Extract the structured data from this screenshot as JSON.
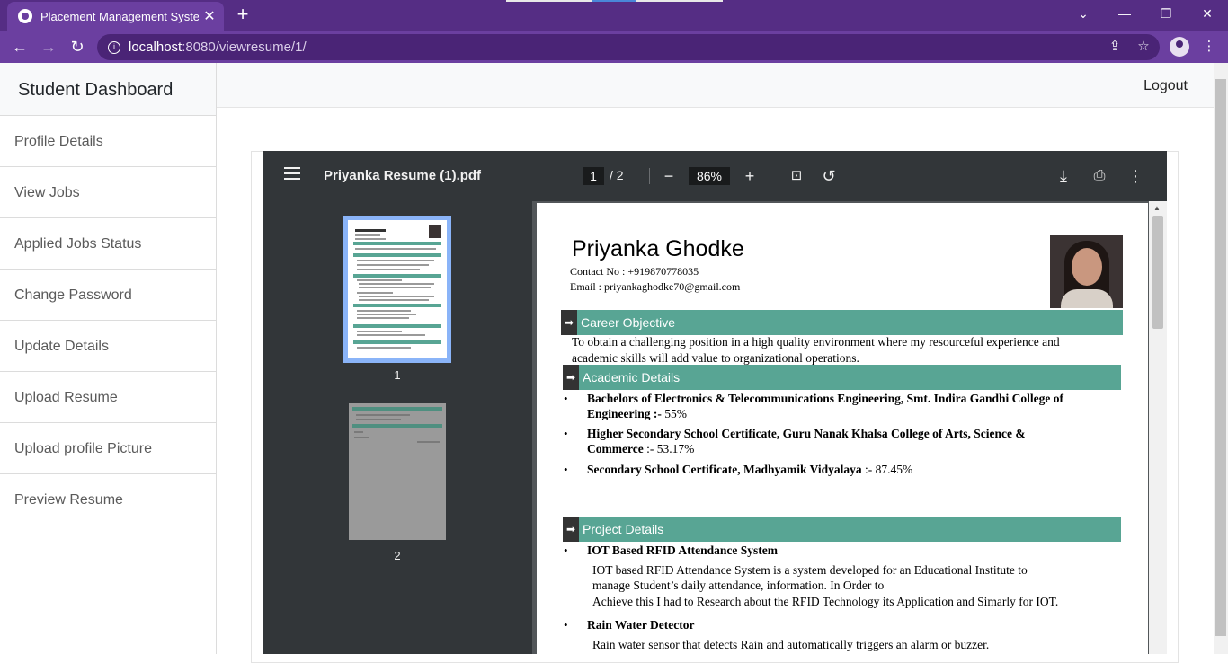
{
  "browser": {
    "tab_title": "Placement Management System",
    "tab_close": "✕",
    "new_tab": "+",
    "url_host": "localhost",
    "url_rest": ":8080/viewresume/1/",
    "window_controls": [
      "⌄",
      "—",
      "❐",
      "✕"
    ]
  },
  "sidebar": {
    "title": "Student Dashboard",
    "items": [
      "Profile Details",
      "View Jobs",
      "Applied Jobs Status",
      "Change Password",
      "Update Details",
      "Upload Resume",
      "Upload profile Picture",
      "Preview Resume"
    ]
  },
  "topnav": {
    "logout": "Logout"
  },
  "pdf_viewer": {
    "file_name": "Priyanka Resume (1).pdf",
    "current_page": "1",
    "page_total": "/  2",
    "zoom": "86%",
    "thumbnails": [
      "1",
      "2"
    ]
  },
  "resume": {
    "name": "Priyanka Ghodke",
    "contact": "Contact No : +919870778035",
    "email": "Email : priyankaghodke70@gmail.com",
    "sections": {
      "career": "Career Objective",
      "academic": "Academic Details",
      "project": "Project Details"
    },
    "objective_line1": "To obtain a challenging position in a high quality environment where my resourceful experience and",
    "objective_line2": "academic skills will add value to organizational operations.",
    "academics": [
      {
        "bold1": "Bachelors of Electronics & Telecommunications Engineering, Smt. Indira Gandhi College of",
        "bold2": "Engineering :-",
        "score": " 55%"
      },
      {
        "bold1": "Higher Secondary School Certificate, Guru Nanak Khalsa College of Arts, Science &",
        "bold2": "Commerce",
        "score": " :- 53.17%"
      },
      {
        "bold1": "Secondary School Certificate, Madhyamik Vidyalaya",
        "bold2": "",
        "score": " :- 87.45%"
      }
    ],
    "projects": [
      {
        "title": "IOT Based RFID Attendance System",
        "lines": [
          "IOT based RFID Attendance System is a system developed for an Educational Institute to",
          "manage Student’s daily attendance, information. In Order to",
          "Achieve this I had to Research about the RFID Technology its Application and Simarly for IOT."
        ]
      },
      {
        "title": "Rain Water Detector",
        "lines": [
          "Rain water sensor that detects Rain and automatically triggers an alarm or buzzer."
        ]
      }
    ]
  },
  "colors": {
    "section_band": "#58a594",
    "chrome": "#6b3fa0",
    "tabbar": "#552d84"
  }
}
